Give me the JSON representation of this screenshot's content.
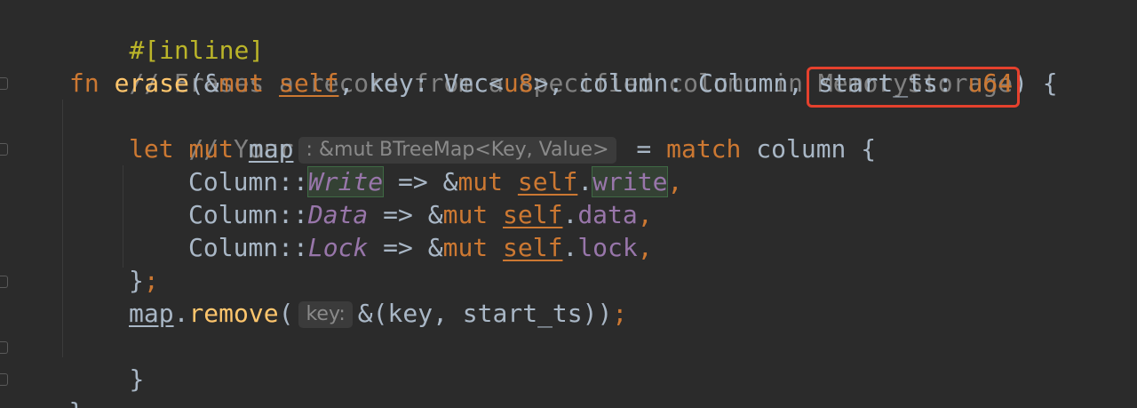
{
  "editor": {
    "lines": {
      "l1": {
        "attr": "#[inline]"
      },
      "l2": {
        "comment": "// Erases a record from a specified column in MemoryStorage."
      },
      "l3": {
        "kw_fn": "fn",
        "name": "erase",
        "p1": "(&",
        "kw_mut": "mut",
        "self": "self",
        "p2": ", key: Vec<",
        "u8": "u8",
        "p3": ">, column: Column, ",
        "start_ts": "start_ts: ",
        "u64": "u64",
        "p4": ") {"
      },
      "l4": {
        "comment": "// Your code here."
      },
      "l5": {
        "kw_let": "let",
        "kw_mut": "mut",
        "var": "map",
        "hint": ": &mut BTreeMap<Key, Value>",
        "eq": " = ",
        "kw_match": "match",
        "rest": " column {"
      },
      "l6": {
        "path": "Column::",
        "variant": "Write",
        "arrow": " => &",
        "kw_mut": "mut",
        "self": "self",
        "dot": ".",
        "field": "write",
        "comma": ","
      },
      "l7": {
        "path": "Column::",
        "variant": "Data",
        "arrow": " => &",
        "kw_mut": "mut",
        "self": "self",
        "dot": ".",
        "field": "data",
        "comma": ","
      },
      "l8": {
        "path": "Column::",
        "variant": "Lock",
        "arrow": " => &",
        "kw_mut": "mut",
        "self": "self",
        "dot": ".",
        "field": "lock",
        "comma": ","
      },
      "l9": {
        "brace": "}",
        "semi": ";"
      },
      "l10": {
        "var": "map",
        "dot": ".",
        "method": "remove",
        "open": "(",
        "hint": "key:",
        "args": "&(key, start_ts))",
        "semi": ";"
      },
      "l11": {
        "brace": "}"
      },
      "l12": {
        "brace": "}"
      }
    },
    "highlight_color": "#e5412d"
  }
}
